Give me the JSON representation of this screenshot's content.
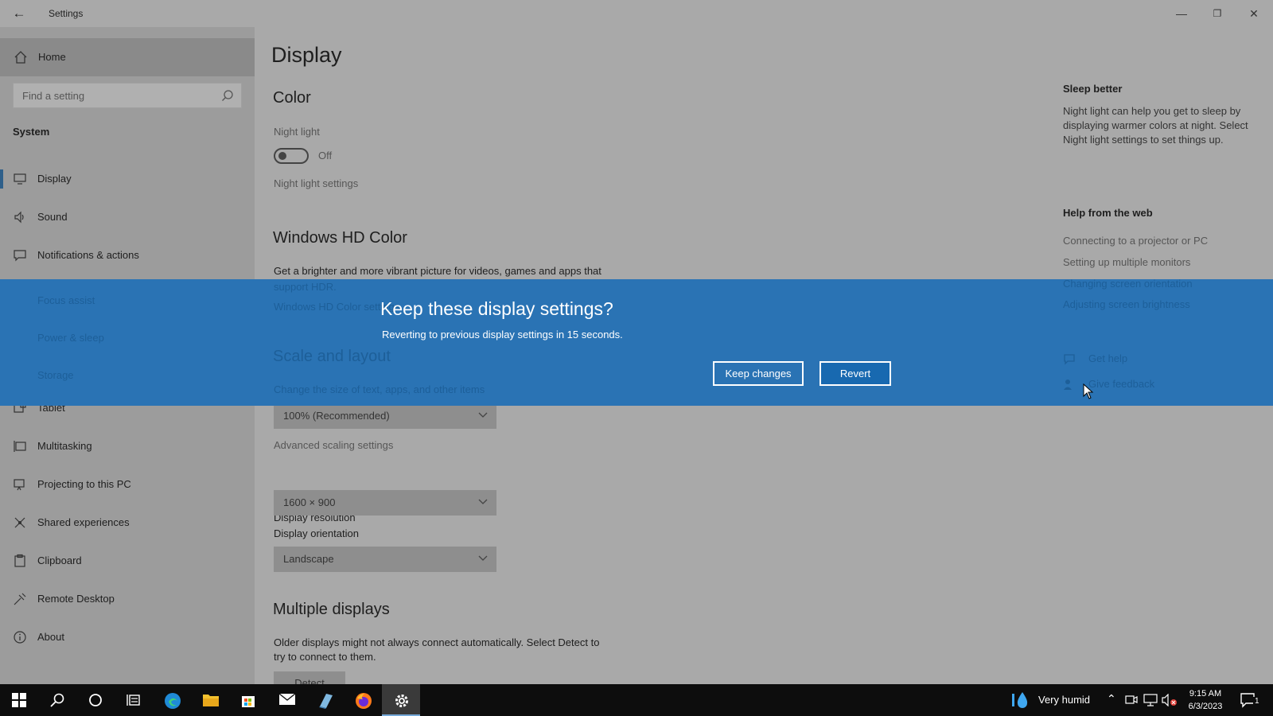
{
  "window": {
    "title": "Settings",
    "controls": {
      "minimize": "—",
      "restore": "❐",
      "close": "✕"
    }
  },
  "sidebar": {
    "home": "Home",
    "search_placeholder": "Find a setting",
    "section": "System",
    "items": [
      {
        "label": "Display",
        "icon": "monitor-icon"
      },
      {
        "label": "Sound",
        "icon": "speaker-icon"
      },
      {
        "label": "Notifications & actions",
        "icon": "notification-icon"
      },
      {
        "label": "Focus assist",
        "icon": "moon-icon"
      },
      {
        "label": "Power & sleep",
        "icon": "power-icon"
      },
      {
        "label": "Storage",
        "icon": "storage-icon"
      },
      {
        "label": "Tablet",
        "icon": "tablet-icon"
      },
      {
        "label": "Multitasking",
        "icon": "multitasking-icon"
      },
      {
        "label": "Projecting to this PC",
        "icon": "projector-icon"
      },
      {
        "label": "Shared experiences",
        "icon": "shared-icon"
      },
      {
        "label": "Clipboard",
        "icon": "clipboard-icon"
      },
      {
        "label": "Remote Desktop",
        "icon": "remote-icon"
      },
      {
        "label": "About",
        "icon": "info-icon"
      }
    ]
  },
  "main": {
    "title": "Display",
    "color": {
      "heading": "Color",
      "night_light_label": "Night light",
      "toggle_state": "Off",
      "night_light_settings": "Night light settings"
    },
    "hd_color": {
      "heading": "Windows HD Color",
      "description_line1": "Get a brighter and more vibrant picture for videos, games and apps that",
      "description_line2": "support HDR.",
      "link": "Windows HD Color settings"
    },
    "scale": {
      "heading": "Scale and layout",
      "change_size_label": "Change the size of text, apps, and other items",
      "scale_value": "100% (Recommended)",
      "advanced_link": "Advanced scaling settings",
      "resolution_label": "Display resolution",
      "resolution_value": "1600 × 900",
      "orientation_label": "Display orientation",
      "orientation_value": "Landscape"
    },
    "multiple": {
      "heading": "Multiple displays",
      "description_line1": "Older displays might not always connect automatically. Select Detect to",
      "description_line2": "try to connect to them.",
      "detect_button": "Detect"
    }
  },
  "right_pane": {
    "sleep_heading": "Sleep better",
    "sleep_text": "Night light can help you get to sleep by displaying warmer colors at night. Select Night light settings to set things up.",
    "help_heading": "Help from the web",
    "help_links": [
      "Connecting to a projector or PC",
      "Setting up multiple monitors",
      "Changing screen orientation",
      "Adjusting screen brightness"
    ],
    "get_help": "Get help",
    "give_feedback": "Give feedback"
  },
  "banner": {
    "title": "Keep these display settings?",
    "subtitle": "Reverting to previous display settings in 15 seconds.",
    "keep_button": "Keep changes",
    "revert_button": "Revert",
    "color": "#2a73b4"
  },
  "taskbar": {
    "weather": "Very humid",
    "time": "9:15 AM",
    "date": "6/3/2023",
    "notification_count": "1"
  }
}
